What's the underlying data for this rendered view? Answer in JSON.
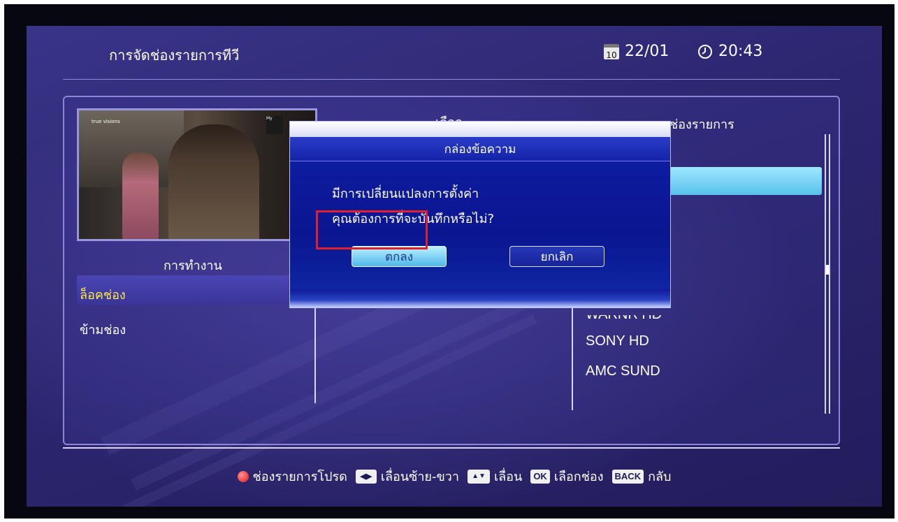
{
  "header": {
    "title": "การจัดช่องรายการทีวี",
    "calendar_day": "10",
    "date": "22/01",
    "time": "20:43"
  },
  "preview": {
    "logo_text": "true visions",
    "corner_logo_text": "My"
  },
  "columns": {
    "operation": "การทำงาน",
    "select": "เลือก",
    "channel": "ช่องรายการ"
  },
  "menu": {
    "items": [
      {
        "label": "ล็อคช่อง"
      },
      {
        "label": "ข้ามช่อง"
      }
    ]
  },
  "channels": [
    {
      "label": "WARNR HD"
    },
    {
      "label": "SONY HD"
    },
    {
      "label": "AMC SUND"
    }
  ],
  "dialog": {
    "title": "กล่องข้อความ",
    "message_line1": "มีการเปลี่ยนแปลงการตั้งค่า",
    "message_line2": "คุณต้องการที่จะบันทึกหรือไม่?",
    "ok_label": "ตกลง",
    "cancel_label": "ยกเลิก"
  },
  "footer": {
    "favorites": "ช่องรายการโปรด",
    "move_lr_key": "◀▶",
    "move_lr": "เลื่อนซ้าย-ขวา",
    "move_ud_key": "▲▼",
    "move_ud": "เลื่อน",
    "ok_key": "OK",
    "ok_text": "เลือกช่อง",
    "back_key": "BACK",
    "back_text": "กลับ"
  },
  "colors": {
    "accent_highlight": "#57c2ea",
    "menu_selected_text": "#ffe84a",
    "focus_outline": "#e0202c"
  }
}
